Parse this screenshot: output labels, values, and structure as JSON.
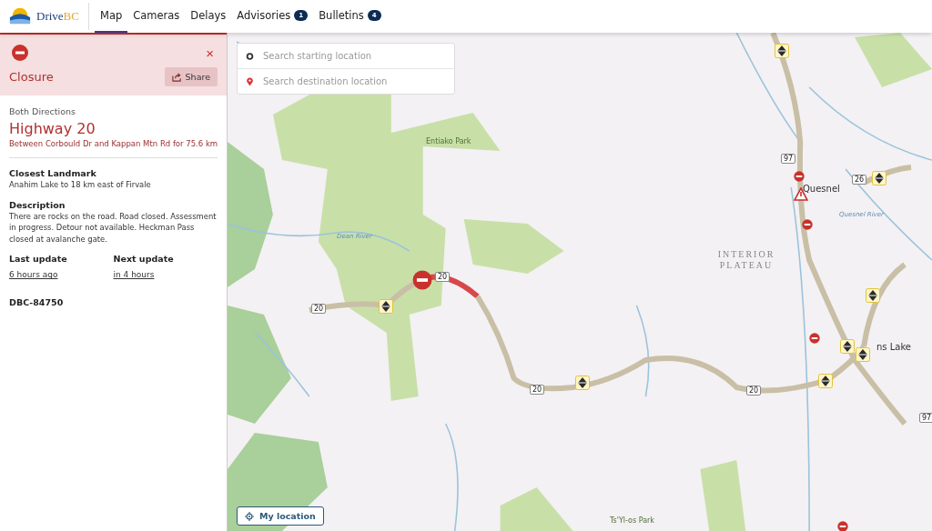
{
  "header": {
    "logo_text": "Drive",
    "logo_text_accent": "BC",
    "nav": [
      {
        "label": "Map",
        "selected": true
      },
      {
        "label": "Cameras",
        "selected": false
      },
      {
        "label": "Delays",
        "selected": false
      },
      {
        "label": "Advisories",
        "selected": false,
        "badge": "1"
      },
      {
        "label": "Bulletins",
        "selected": false,
        "badge": "4"
      }
    ]
  },
  "panel": {
    "kind": "closure",
    "type": "Closure",
    "close": "×",
    "share": "Share",
    "direction": "Both Directions",
    "highway": "Highway 20",
    "segment": "Between Corbould Dr and Kappan Mtn Rd for 75.6 km",
    "sections": [
      {
        "title": "Closest Landmark",
        "text": "Anahim Lake to 18 km east of Firvale"
      },
      {
        "title": "Description",
        "text": "There are rocks on the road. Road closed. Assessment in progress. Detour not available. Heckman Pass closed at avalanche gate."
      }
    ],
    "updates": [
      {
        "label": "Last update",
        "value": "6 hours ago"
      },
      {
        "label": "Next update",
        "value": "in 4 hours"
      }
    ],
    "id": "DBC-84750"
  },
  "search": {
    "start_placeholder": "Search starting location",
    "destination_placeholder": "Search destination location"
  },
  "map": {
    "labels": [
      {
        "kind": "park",
        "text": "Entiako Park"
      },
      {
        "kind": "place",
        "text": "Quesnel"
      },
      {
        "kind": "region",
        "text": "INTERIOR PLATEAU"
      },
      {
        "kind": "river",
        "text": "Dean River"
      },
      {
        "kind": "river",
        "text": "Quesnel River"
      },
      {
        "kind": "place",
        "text": "ns Lake"
      },
      {
        "kind": "park",
        "text": "Ts'Yl-os Park"
      },
      {
        "kind": "shield",
        "text": "20"
      },
      {
        "kind": "shield",
        "text": "20"
      },
      {
        "kind": "shield",
        "text": "20"
      },
      {
        "kind": "shield",
        "text": "20"
      },
      {
        "kind": "shield",
        "text": "97"
      },
      {
        "kind": "shield",
        "text": "26"
      },
      {
        "kind": "shield",
        "text": "97"
      }
    ],
    "my_location": "My location"
  }
}
